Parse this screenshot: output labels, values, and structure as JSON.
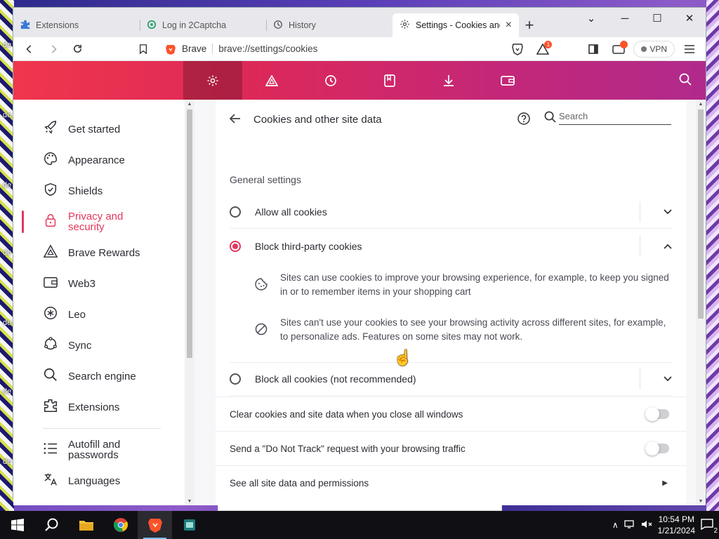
{
  "desktop": {
    "labels": [
      "de",
      "de",
      "de",
      "de",
      "de",
      "de",
      "de",
      "de"
    ]
  },
  "browser": {
    "tabs": [
      {
        "title": "Extensions",
        "icon": "puzzle-icon"
      },
      {
        "title": "Log in 2Captcha",
        "icon": "captcha-icon"
      },
      {
        "title": "History",
        "icon": "history-icon"
      },
      {
        "title": "Settings - Cookies and",
        "icon": "gear-icon",
        "active": true
      }
    ],
    "new_tab": "+",
    "omnibox": {
      "site_name": "Brave",
      "url": "brave://settings/cookies"
    },
    "vpn_label": "VPN",
    "rewards_badge": "1"
  },
  "settings": {
    "header_icons": [
      "gear-icon",
      "rewards-triangle-icon",
      "history-icon",
      "bookmarks-icon",
      "downloads-icon",
      "wallet-icon"
    ],
    "sidebar": {
      "items": [
        {
          "label": "Get started",
          "icon": "rocket-icon"
        },
        {
          "label": "Appearance",
          "icon": "palette-icon"
        },
        {
          "label": "Shields",
          "icon": "shield-icon"
        },
        {
          "label": "Privacy and security",
          "icon": "lock-icon",
          "active": true
        },
        {
          "label": "Brave Rewards",
          "icon": "rewards-triangle-icon"
        },
        {
          "label": "Web3",
          "icon": "wallet-icon"
        },
        {
          "label": "Leo",
          "icon": "leo-icon"
        },
        {
          "label": "Sync",
          "icon": "sync-icon"
        },
        {
          "label": "Search engine",
          "icon": "search-icon"
        },
        {
          "label": "Extensions",
          "icon": "puzzle-icon"
        },
        {
          "label": "Autofill and passwords",
          "icon": "list-icon"
        },
        {
          "label": "Languages",
          "icon": "translate-icon"
        }
      ]
    },
    "page": {
      "title": "Cookies and other site data",
      "search_placeholder": "Search",
      "section_label": "General settings",
      "options": [
        {
          "label": "Allow all cookies",
          "selected": false
        },
        {
          "label": "Block third-party cookies",
          "selected": true
        },
        {
          "label": "Block all cookies (not recommended)",
          "selected": false
        }
      ],
      "descriptions": [
        {
          "icon": "cookie-icon",
          "text": "Sites can use cookies to improve your browsing experience, for example, to keep you signed in or to remember items in your shopping cart"
        },
        {
          "icon": "block-icon",
          "text": "Sites can't use your cookies to see your browsing activity across different sites, for example, to personalize ads. Features on some sites may not work."
        }
      ],
      "toggles": [
        {
          "label": "Clear cookies and site data when you close all windows",
          "on": false
        },
        {
          "label": "Send a \"Do Not Track\" request with your browsing traffic",
          "on": false
        }
      ],
      "link_row": "See all site data and permissions"
    }
  },
  "taskbar": {
    "time": "10:54 PM",
    "date": "1/21/2024",
    "notifications": "2"
  },
  "colors": {
    "accent": "#e3375c",
    "header_start": "#f0364c",
    "header_end": "#b02a8c"
  }
}
